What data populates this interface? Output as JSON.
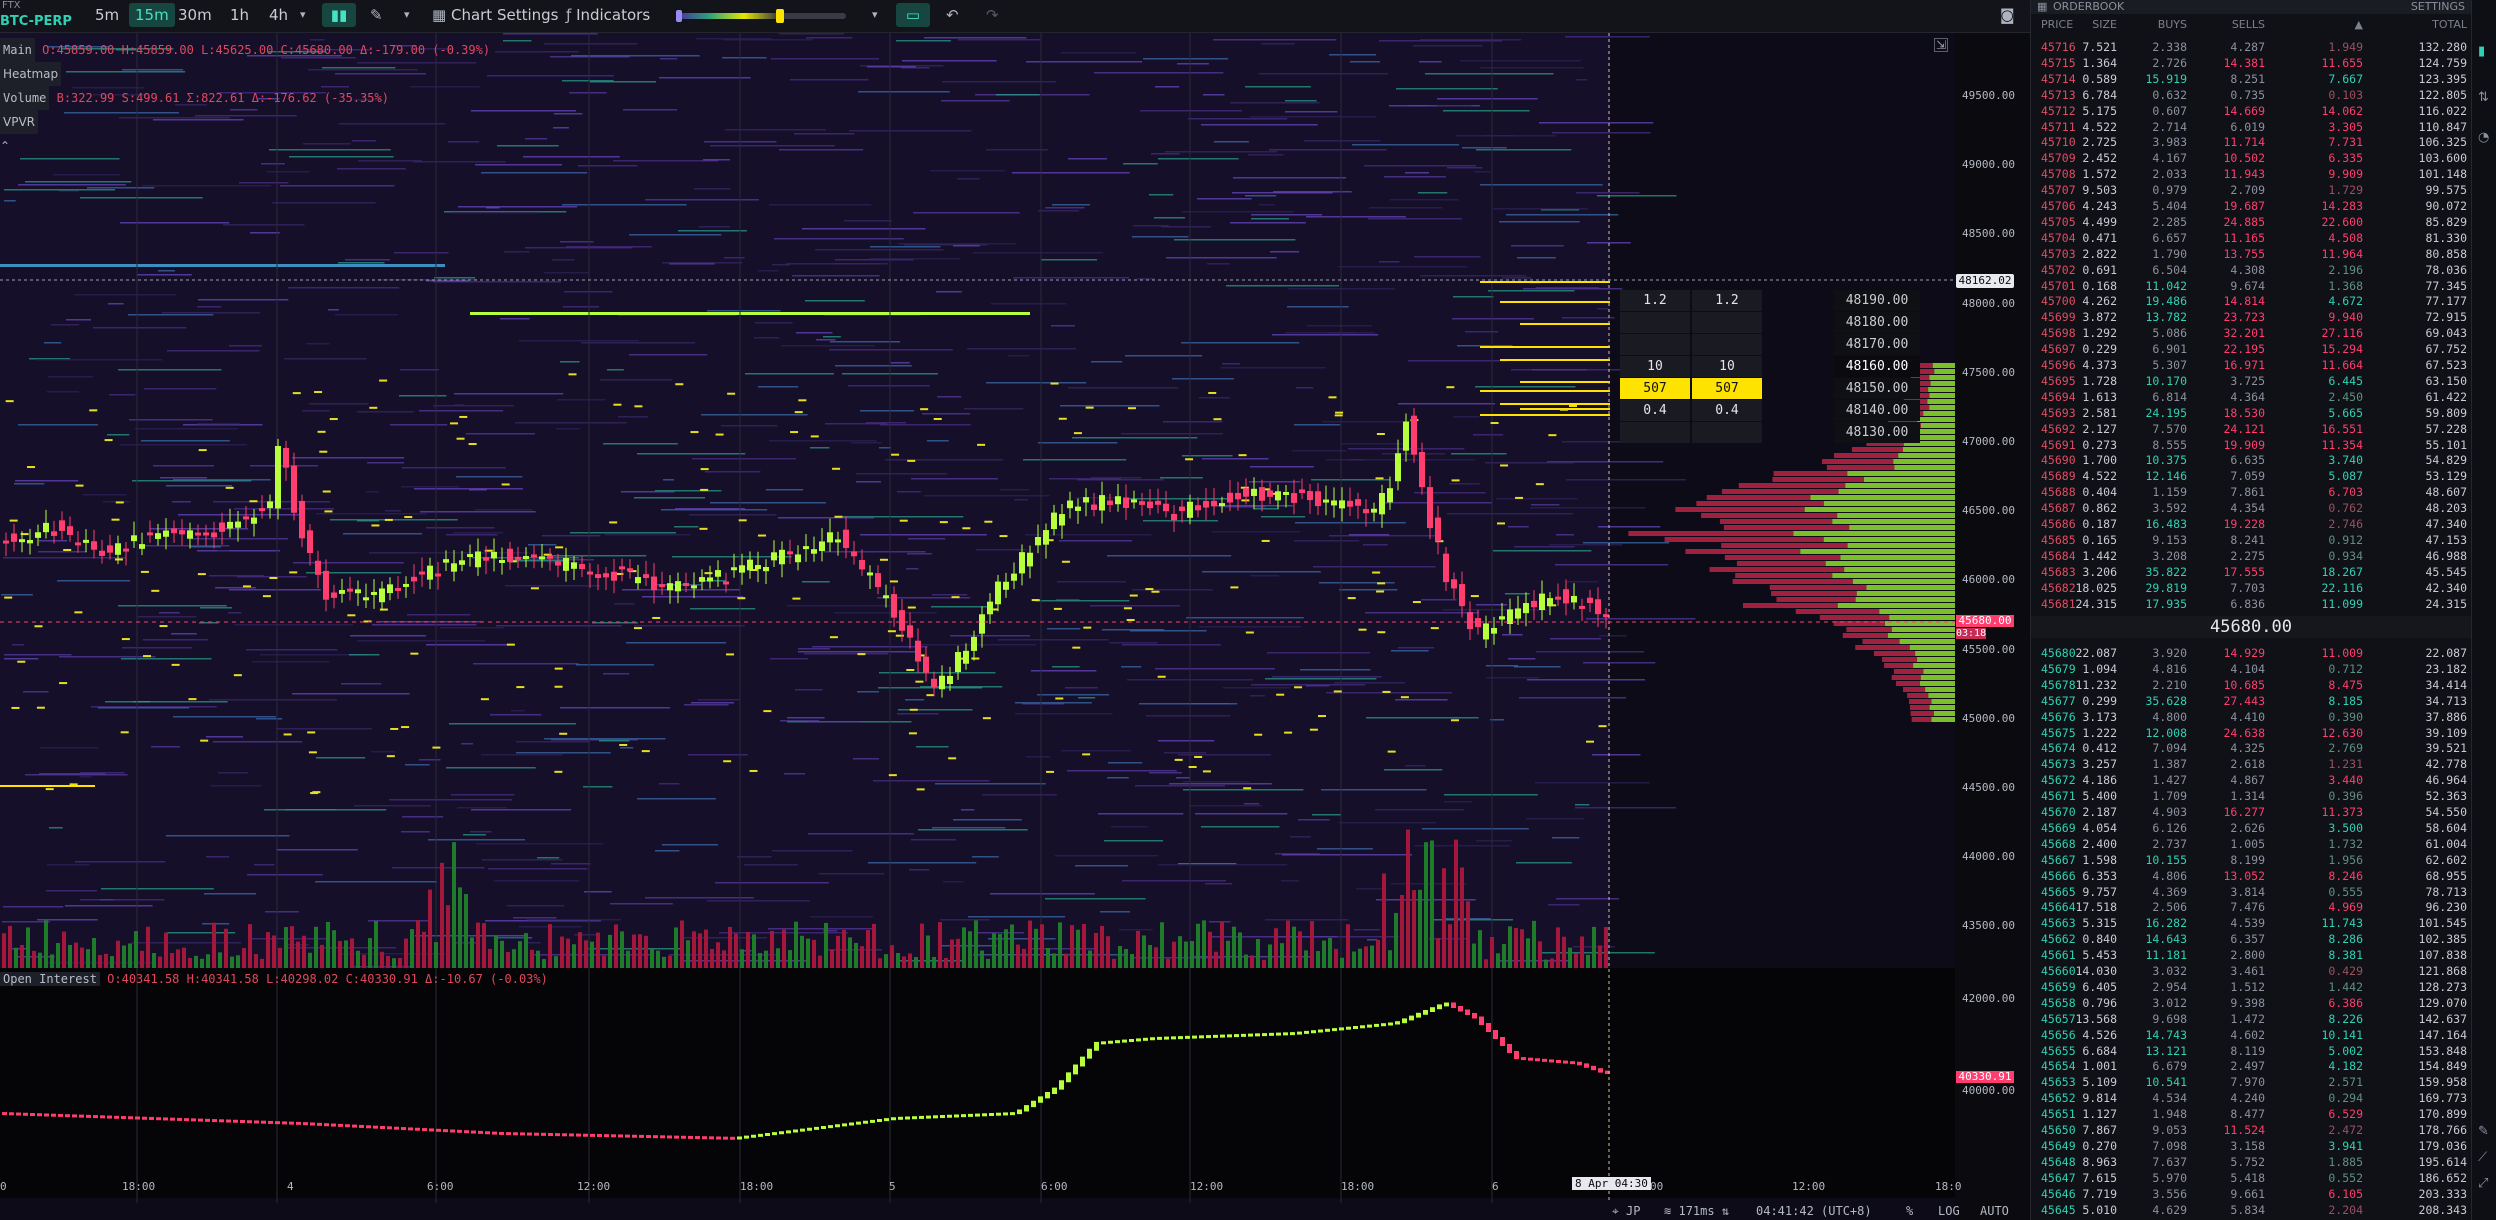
{
  "exchange": "FTX",
  "symbol": "BTC-PERP",
  "timeframes": [
    "5m",
    "15m",
    "30m",
    "1h",
    "4h"
  ],
  "active_timeframe": "15m",
  "toolbar": {
    "chart_settings": "Chart Settings",
    "indicators": "Indicators"
  },
  "legend": {
    "main_tag": "Main",
    "main_ohlc": "O:45859.00 H:45859.00 L:45625.00 C:45680.00 Δ:-179.00 (-0.39%)",
    "heatmap_tag": "Heatmap",
    "volume_tag": "Volume",
    "volume_vals": "B:322.99 S:499.61 Σ:822.61 Δ:-176.62 (-35.35%)",
    "vpvr_tag": "VPVR",
    "oi_tag": "Open Interest",
    "oi_vals": "O:40341.58 H:40341.58 L:40298.02 C:40330.91 Δ:-10.67 (-0.03%)"
  },
  "price_axis": [
    "49500.00",
    "49000.00",
    "48500.00",
    "48000.00",
    "47500.00",
    "47000.00",
    "46500.00",
    "46000.00",
    "45500.00",
    "45000.00",
    "44500.00",
    "44000.00",
    "43500.00"
  ],
  "crosshair_price": "48162.02",
  "last_price_label": "45680.00",
  "last_price_timer": "03:18",
  "oi_axis": [
    "42000.00",
    "40000.00"
  ],
  "oi_last": "40330.91",
  "time_axis": [
    "0",
    "18:00",
    "4",
    "6:00",
    "12:00",
    "18:00",
    "5",
    "6:00",
    "12:00",
    "18:00",
    "6",
    "8 Apr 04:30",
    "00",
    "12:00",
    "18:0"
  ],
  "ladder": {
    "rows": [
      {
        "l": "1.2",
        "r": "1.2",
        "p": "48190.00"
      },
      {
        "l": "",
        "r": "",
        "p": "48180.00"
      },
      {
        "l": "",
        "r": "",
        "p": "48170.00"
      },
      {
        "l": "10",
        "r": "10",
        "p": "48160.00"
      },
      {
        "l": "507",
        "r": "507",
        "p": "48150.00"
      },
      {
        "l": "0.4",
        "r": "0.4",
        "p": "48140.00"
      },
      {
        "l": "",
        "r": "",
        "p": "48130.00"
      }
    ]
  },
  "status": {
    "region": "JP",
    "latency": "171ms",
    "clock": "04:41:42 (UTC+8)",
    "pct": "%",
    "log": "LOG",
    "auto": "AUTO"
  },
  "orderbook": {
    "title": "ORDERBOOK",
    "settings": "SETTINGS",
    "columns": [
      "PRICE",
      "SIZE",
      "BUYS",
      "SELLS",
      "▲",
      "TOTAL"
    ],
    "mid": "45680.00",
    "asks": [
      [
        "45716",
        "7.521",
        "2.338",
        "4.287",
        "1.949",
        "132.280"
      ],
      [
        "45715",
        "1.364",
        "2.726",
        "14.381",
        "11.655",
        "124.759"
      ],
      [
        "45714",
        "0.589",
        "15.919",
        "8.251",
        "7.667",
        "123.395"
      ],
      [
        "45713",
        "6.784",
        "0.632",
        "0.735",
        "0.103",
        "122.805"
      ],
      [
        "45712",
        "5.175",
        "0.607",
        "14.669",
        "14.062",
        "116.022"
      ],
      [
        "45711",
        "4.522",
        "2.714",
        "6.019",
        "3.305",
        "110.847"
      ],
      [
        "45710",
        "2.725",
        "3.983",
        "11.714",
        "7.731",
        "106.325"
      ],
      [
        "45709",
        "2.452",
        "4.167",
        "10.502",
        "6.335",
        "103.600"
      ],
      [
        "45708",
        "1.572",
        "2.033",
        "11.943",
        "9.909",
        "101.148"
      ],
      [
        "45707",
        "9.503",
        "0.979",
        "2.709",
        "1.729",
        "99.575"
      ],
      [
        "45706",
        "4.243",
        "5.404",
        "19.687",
        "14.283",
        "90.072"
      ],
      [
        "45705",
        "4.499",
        "2.285",
        "24.885",
        "22.600",
        "85.829"
      ],
      [
        "45704",
        "0.471",
        "6.657",
        "11.165",
        "4.508",
        "81.330"
      ],
      [
        "45703",
        "2.822",
        "1.790",
        "13.755",
        "11.964",
        "80.858"
      ],
      [
        "45702",
        "0.691",
        "6.504",
        "4.308",
        "2.196",
        "78.036"
      ],
      [
        "45701",
        "0.168",
        "11.042",
        "9.674",
        "1.368",
        "77.345"
      ],
      [
        "45700",
        "4.262",
        "19.486",
        "14.814",
        "4.672",
        "77.177"
      ],
      [
        "45699",
        "3.872",
        "13.782",
        "23.723",
        "9.940",
        "72.915"
      ],
      [
        "45698",
        "1.292",
        "5.086",
        "32.201",
        "27.116",
        "69.043"
      ],
      [
        "45697",
        "0.229",
        "6.901",
        "22.195",
        "15.294",
        "67.752"
      ],
      [
        "45696",
        "4.373",
        "5.307",
        "16.971",
        "11.664",
        "67.523"
      ],
      [
        "45695",
        "1.728",
        "10.170",
        "3.725",
        "6.445",
        "63.150"
      ],
      [
        "45694",
        "1.613",
        "6.814",
        "4.364",
        "2.450",
        "61.422"
      ],
      [
        "45693",
        "2.581",
        "24.195",
        "18.530",
        "5.665",
        "59.809"
      ],
      [
        "45692",
        "2.127",
        "7.570",
        "24.121",
        "16.551",
        "57.228"
      ],
      [
        "45691",
        "0.273",
        "8.555",
        "19.909",
        "11.354",
        "55.101"
      ],
      [
        "45690",
        "1.700",
        "10.375",
        "6.635",
        "3.740",
        "54.829"
      ],
      [
        "45689",
        "4.522",
        "12.146",
        "7.059",
        "5.087",
        "53.129"
      ],
      [
        "45688",
        "0.404",
        "1.159",
        "7.861",
        "6.703",
        "48.607"
      ],
      [
        "45687",
        "0.862",
        "3.592",
        "4.354",
        "0.762",
        "48.203"
      ],
      [
        "45686",
        "0.187",
        "16.483",
        "19.228",
        "2.746",
        "47.340"
      ],
      [
        "45685",
        "0.165",
        "9.153",
        "8.241",
        "0.912",
        "47.153"
      ],
      [
        "45684",
        "1.442",
        "3.208",
        "2.275",
        "0.934",
        "46.988"
      ],
      [
        "45683",
        "3.206",
        "35.822",
        "17.555",
        "18.267",
        "45.545"
      ],
      [
        "45682",
        "18.025",
        "29.819",
        "7.703",
        "22.116",
        "42.340"
      ],
      [
        "45681",
        "24.315",
        "17.935",
        "6.836",
        "11.099",
        "24.315"
      ]
    ],
    "bids": [
      [
        "45680",
        "22.087",
        "3.920",
        "14.929",
        "11.009",
        "22.087"
      ],
      [
        "45679",
        "1.094",
        "4.816",
        "4.104",
        "0.712",
        "23.182"
      ],
      [
        "45678",
        "11.232",
        "2.210",
        "10.685",
        "8.475",
        "34.414"
      ],
      [
        "45677",
        "0.299",
        "35.628",
        "27.443",
        "8.185",
        "34.713"
      ],
      [
        "45676",
        "3.173",
        "4.800",
        "4.410",
        "0.390",
        "37.886"
      ],
      [
        "45675",
        "1.222",
        "12.008",
        "24.638",
        "12.630",
        "39.109"
      ],
      [
        "45674",
        "0.412",
        "7.094",
        "4.325",
        "2.769",
        "39.521"
      ],
      [
        "45673",
        "3.257",
        "1.387",
        "2.618",
        "1.231",
        "42.778"
      ],
      [
        "45672",
        "4.186",
        "1.427",
        "4.867",
        "3.440",
        "46.964"
      ],
      [
        "45671",
        "5.400",
        "1.709",
        "1.314",
        "0.396",
        "52.363"
      ],
      [
        "45670",
        "2.187",
        "4.903",
        "16.277",
        "11.373",
        "54.550"
      ],
      [
        "45669",
        "4.054",
        "6.126",
        "2.626",
        "3.500",
        "58.604"
      ],
      [
        "45668",
        "2.400",
        "2.737",
        "1.005",
        "1.732",
        "61.004"
      ],
      [
        "45667",
        "1.598",
        "10.155",
        "8.199",
        "1.956",
        "62.602"
      ],
      [
        "45666",
        "6.353",
        "4.806",
        "13.052",
        "8.246",
        "68.955"
      ],
      [
        "45665",
        "9.757",
        "4.369",
        "3.814",
        "0.555",
        "78.713"
      ],
      [
        "45664",
        "17.518",
        "2.506",
        "7.476",
        "4.969",
        "96.230"
      ],
      [
        "45663",
        "5.315",
        "16.282",
        "4.539",
        "11.743",
        "101.545"
      ],
      [
        "45662",
        "0.840",
        "14.643",
        "6.357",
        "8.286",
        "102.385"
      ],
      [
        "45661",
        "5.453",
        "11.181",
        "2.800",
        "8.381",
        "107.838"
      ],
      [
        "45660",
        "14.030",
        "3.032",
        "3.461",
        "0.429",
        "121.868"
      ],
      [
        "45659",
        "6.405",
        "2.954",
        "1.512",
        "1.442",
        "128.273"
      ],
      [
        "45658",
        "0.796",
        "3.012",
        "9.398",
        "6.386",
        "129.070"
      ],
      [
        "45657",
        "13.568",
        "9.698",
        "1.472",
        "8.226",
        "142.637"
      ],
      [
        "45656",
        "4.526",
        "14.743",
        "4.602",
        "10.141",
        "147.164"
      ],
      [
        "45655",
        "6.684",
        "13.121",
        "8.119",
        "5.002",
        "153.848"
      ],
      [
        "45654",
        "1.001",
        "6.679",
        "2.497",
        "4.182",
        "154.849"
      ],
      [
        "45653",
        "5.109",
        "10.541",
        "7.970",
        "2.571",
        "159.958"
      ],
      [
        "45652",
        "9.814",
        "4.534",
        "4.240",
        "0.294",
        "169.773"
      ],
      [
        "45651",
        "1.127",
        "1.948",
        "8.477",
        "6.529",
        "170.899"
      ],
      [
        "45650",
        "7.867",
        "9.053",
        "11.524",
        "2.472",
        "178.766"
      ],
      [
        "45649",
        "0.270",
        "7.098",
        "3.158",
        "3.941",
        "179.036"
      ],
      [
        "45648",
        "8.963",
        "7.637",
        "5.752",
        "1.885",
        "195.614"
      ],
      [
        "45647",
        "7.615",
        "5.970",
        "5.418",
        "0.552",
        "186.652"
      ],
      [
        "45646",
        "7.719",
        "3.556",
        "9.661",
        "6.105",
        "203.333"
      ],
      [
        "45645",
        "5.010",
        "4.629",
        "5.834",
        "2.204",
        "208.343"
      ]
    ]
  },
  "colors": {
    "up": "#b7ff3c",
    "down": "#ff3d6e",
    "teal": "#2fd1b4",
    "accent_yellow": "#ffe300",
    "bg": "#0b0b0f"
  }
}
